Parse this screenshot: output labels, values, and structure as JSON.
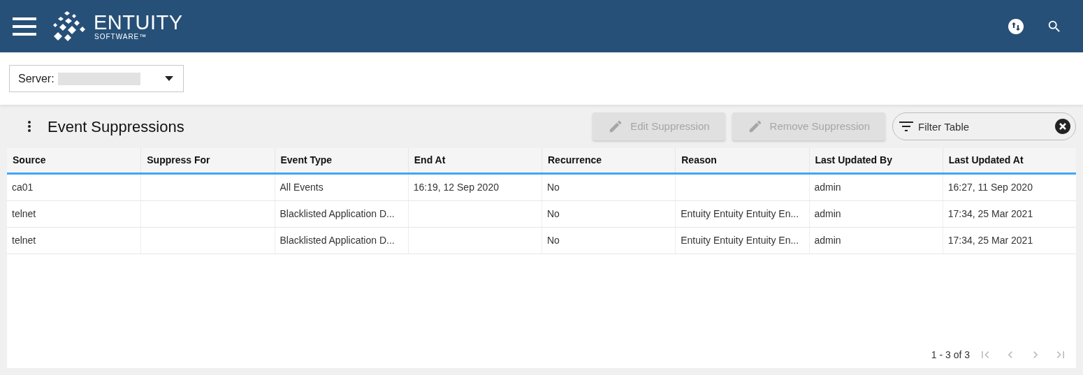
{
  "header": {
    "brand": "ENTUITY",
    "brand_sub": "SOFTWARE™"
  },
  "server_select": {
    "label": "Server:"
  },
  "panel": {
    "title": "Event Suppressions",
    "actions": [
      {
        "label": "Edit Suppression",
        "disabled": true
      },
      {
        "label": "Remove Suppression",
        "disabled": true
      }
    ],
    "filter": {
      "placeholder": "Filter Table"
    }
  },
  "table": {
    "columns": [
      "Source",
      "Suppress For",
      "Event Type",
      "End At",
      "Recurrence",
      "Reason",
      "Last Updated By",
      "Last Updated At"
    ],
    "rows": [
      [
        "ca01",
        "",
        "All Events",
        "16:19, 12 Sep 2020",
        "No",
        "",
        "admin",
        "16:27, 11 Sep 2020"
      ],
      [
        "telnet",
        "",
        "Blacklisted Application D...",
        "",
        "No",
        "Entuity Entuity Entuity En...",
        "admin",
        "17:34, 25 Mar 2021"
      ],
      [
        "telnet",
        "",
        "Blacklisted Application D...",
        "",
        "No",
        "Entuity Entuity Entuity En...",
        "admin",
        "17:34, 25 Mar 2021"
      ]
    ]
  },
  "pagination": {
    "range": "1 - 3 of 3",
    "first_disabled": true,
    "prev_disabled": true,
    "next_disabled": true,
    "last_disabled": true
  }
}
